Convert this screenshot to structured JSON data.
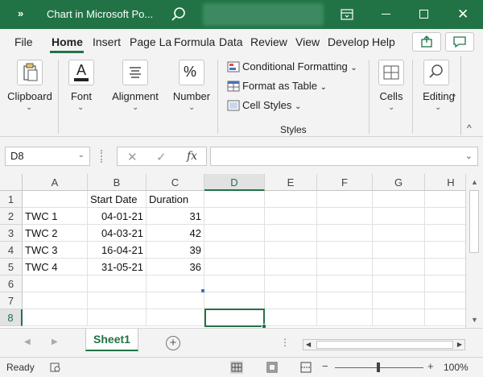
{
  "window": {
    "title": "Chart in Microsoft Po...",
    "chevron": "»",
    "close_glyph": "✕"
  },
  "tabs": [
    {
      "label": "File"
    },
    {
      "label": "Home"
    },
    {
      "label": "Insert"
    },
    {
      "label": "Page La"
    },
    {
      "label": "Formula"
    },
    {
      "label": "Data"
    },
    {
      "label": "Review"
    },
    {
      "label": "View"
    },
    {
      "label": "Develop"
    },
    {
      "label": "Help"
    }
  ],
  "active_tab": "Home",
  "ribbon": {
    "clipboard": "Clipboard",
    "font": "Font",
    "font_glyph": "A",
    "alignment": "Alignment",
    "number": "Number",
    "number_glyph": "%",
    "conditional_formatting": "Conditional Formatting",
    "format_as_table": "Format as Table",
    "cell_styles": "Cell Styles",
    "styles_group": "Styles",
    "cells": "Cells",
    "editing": "Editing",
    "dd_glyph": "⌄",
    "more_glyph": "›",
    "collapse_glyph": "^"
  },
  "formula_bar": {
    "name_box": "D8",
    "cancel_glyph": "✕",
    "enter_glyph": "✓",
    "fx_label": "fx",
    "formula": "",
    "arrow_glyph": "⌄"
  },
  "sheet": {
    "columns": [
      "A",
      "B",
      "C",
      "D",
      "E",
      "F",
      "G",
      "H"
    ],
    "selected_column": "D",
    "rows": [
      "1",
      "2",
      "3",
      "4",
      "5",
      "6",
      "7",
      "8"
    ],
    "selected_row": "8",
    "headers": {
      "b": "Start Date",
      "c": "Duration"
    },
    "data": [
      {
        "name": "TWC 1",
        "start": "04-01-21",
        "duration": "31"
      },
      {
        "name": "TWC 2",
        "start": "04-03-21",
        "duration": "42"
      },
      {
        "name": "TWC 3",
        "start": "16-04-21",
        "duration": "39"
      },
      {
        "name": "TWC 4",
        "start": "31-05-21",
        "duration": "36"
      }
    ],
    "active_cell": "D8"
  },
  "sheet_tabs": {
    "active": "Sheet1",
    "add_glyph": "+",
    "nav_prev": "◀",
    "nav_next": "▶",
    "dots": "⋮"
  },
  "status": {
    "ready": "Ready",
    "zoom_minus": "−",
    "zoom_plus": "+",
    "zoom": "100%"
  },
  "colors": {
    "accent": "#217346"
  }
}
